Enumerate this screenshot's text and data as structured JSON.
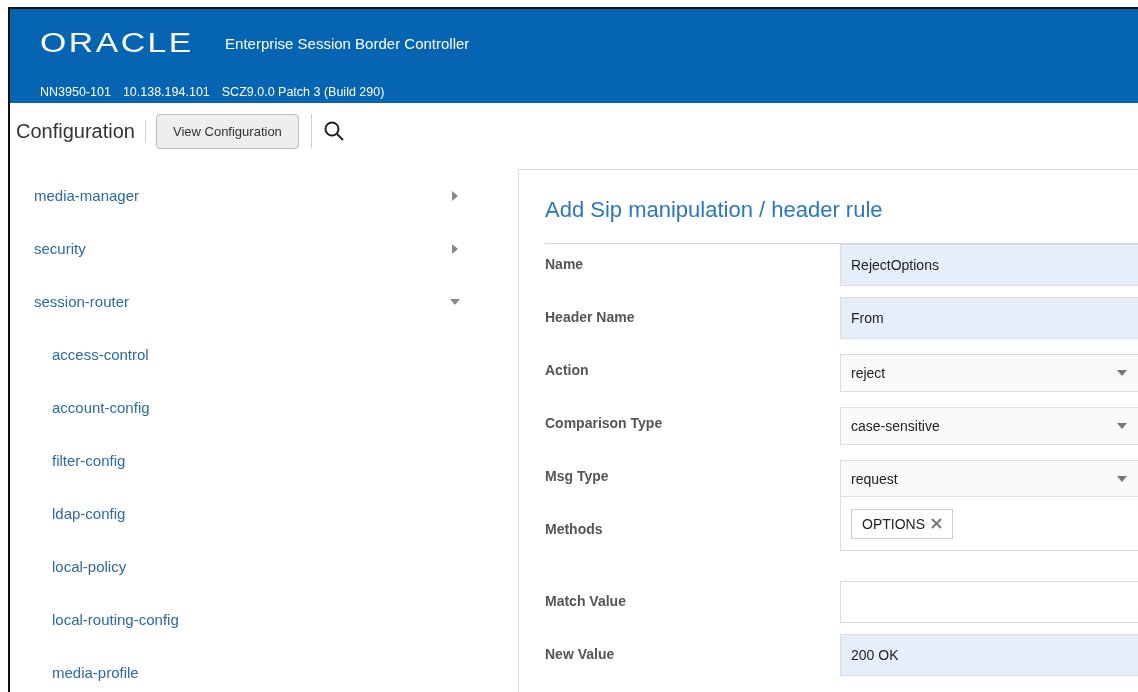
{
  "header": {
    "logo": "ORACLE",
    "product": "Enterprise Session Border Controller",
    "info": [
      "NN3950-101",
      "10.138.194.101",
      "SCZ9.0.0 Patch 3 (Build 290)"
    ]
  },
  "toolbar": {
    "title": "Configuration",
    "button": "View Configuration"
  },
  "sidebar": {
    "items": [
      {
        "label": "media-manager",
        "expanded": false
      },
      {
        "label": "security",
        "expanded": false
      },
      {
        "label": "session-router",
        "expanded": true,
        "children": [
          {
            "label": "access-control"
          },
          {
            "label": "account-config"
          },
          {
            "label": "filter-config"
          },
          {
            "label": "ldap-config"
          },
          {
            "label": "local-policy"
          },
          {
            "label": "local-routing-config"
          },
          {
            "label": "media-profile"
          }
        ]
      }
    ]
  },
  "form": {
    "title": "Add Sip manipulation / header rule",
    "fields": [
      {
        "label": "Name",
        "kind": "text",
        "value": "RejectOptions",
        "filled": true
      },
      {
        "label": "Header Name",
        "kind": "text",
        "value": "From",
        "filled": true
      },
      {
        "label": "Action",
        "kind": "select",
        "value": "reject"
      },
      {
        "label": "Comparison Type",
        "kind": "select",
        "value": "case-sensitive"
      },
      {
        "label": "Msg Type",
        "kind": "select",
        "value": "request"
      },
      {
        "label": "Methods",
        "kind": "tags",
        "tags": [
          "OPTIONS"
        ]
      },
      {
        "label": "Match Value",
        "kind": "text",
        "filled": false
      },
      {
        "label": "New Value",
        "kind": "text",
        "value": "200 OK",
        "filled": true
      }
    ]
  }
}
